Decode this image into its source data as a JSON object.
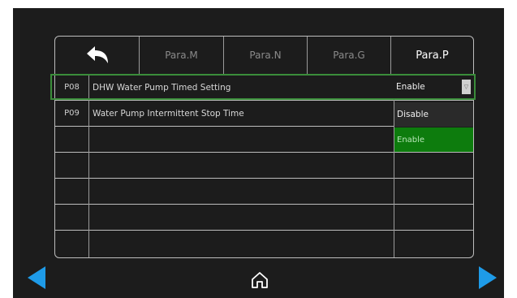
{
  "tabs": [
    {
      "label": ""
    },
    {
      "label": "Para.M"
    },
    {
      "label": "Para.N"
    },
    {
      "label": "Para.G"
    },
    {
      "label": "Para.P"
    }
  ],
  "params": [
    {
      "code": "P08",
      "name": "DHW Water Pump Timed Setting",
      "value": "Enable"
    },
    {
      "code": "P09",
      "name": "Water Pump Intermittent Stop Time",
      "value": ""
    }
  ],
  "dropdown": {
    "selected": "Enable",
    "options": [
      "Disable",
      "Enable"
    ],
    "highlighted": "Enable",
    "arrow": "▽"
  },
  "icons": {
    "back": "back-arrow-icon",
    "home": "home-icon",
    "prev": "prev-page-icon",
    "next": "next-page-icon"
  },
  "colors": {
    "accent_blue": "#1e9be8",
    "selection_green": "#3a8d3a",
    "highlight_green": "#0d7c0d",
    "background": "#1c1c1c"
  }
}
